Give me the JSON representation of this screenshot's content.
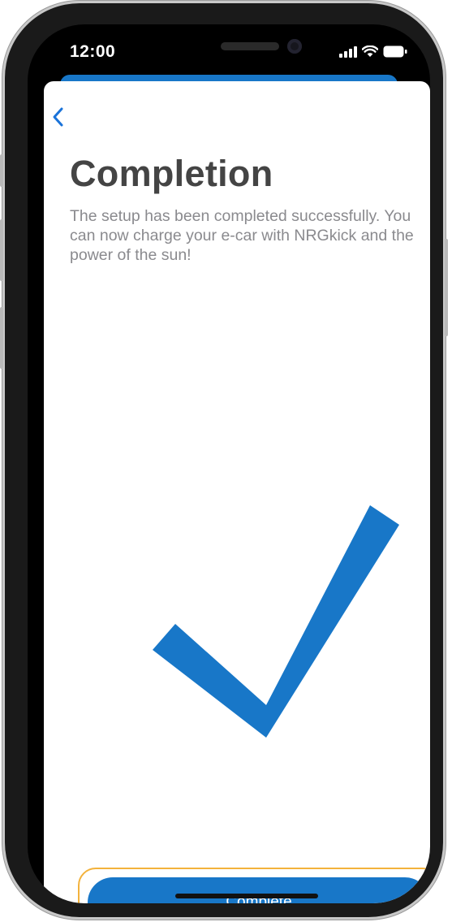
{
  "status_bar": {
    "time": "12:00",
    "icons": [
      "cellular-signal-icon",
      "wifi-icon",
      "battery-icon"
    ]
  },
  "navigation": {
    "back_icon": "chevron-left-icon"
  },
  "content": {
    "title": "Completion",
    "description": "The setup has been completed successfully. You can now charge your e-car with NRGkick and the power of the sun!",
    "illustration_icon": "checkmark-icon"
  },
  "actions": {
    "complete_label": "Complete"
  },
  "colors": {
    "accent": "#1877c8",
    "title": "#444444",
    "description": "#8a8a8e",
    "highlight_outline": "#f3b23c",
    "frame": "#1a1a1a"
  }
}
